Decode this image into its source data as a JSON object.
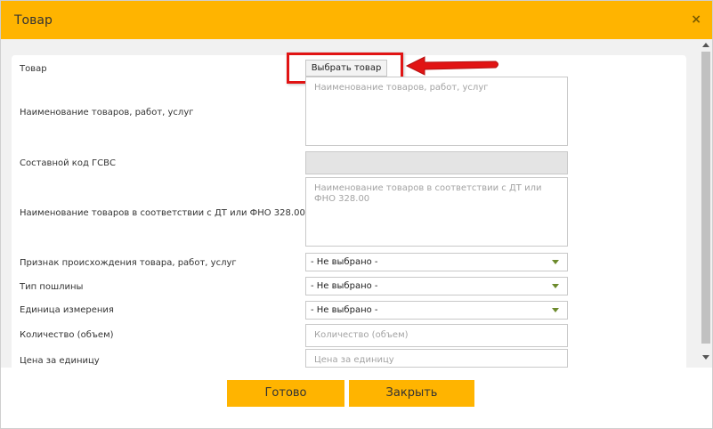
{
  "dialog": {
    "title": "Товар",
    "close_symbol": "×"
  },
  "form": {
    "product_label": "Товар",
    "select_product_button": "Выбрать товар",
    "goods_name_label": "Наименование товаров, работ, услуг",
    "goods_name_placeholder": "Наименование товаров, работ, услуг",
    "gsvs_code_label": "Составной код ГСВС",
    "dt_name_label": "Наименование товаров в соответствии с ДТ или ФНО 328.00",
    "dt_name_placeholder": "Наименование товаров в соответствии с ДТ или ФНО 328.00",
    "origin_label": "Признак происхождения товара, работ, услуг",
    "origin_value": "- Не выбрано -",
    "duty_type_label": "Тип пошлины",
    "duty_type_value": "- Не выбрано -",
    "unit_label": "Единица измерения",
    "unit_value": "- Не выбрано -",
    "quantity_label": "Количество (объем)",
    "quantity_placeholder": "Количество (объем)",
    "price_label": "Цена за единицу",
    "price_placeholder": "Цена за единицу"
  },
  "footer": {
    "done_button": "Готово",
    "close_button": "Закрыть"
  },
  "colors": {
    "accent": "#ffb400",
    "highlight": "#e11414",
    "caret": "#6c8a2c"
  },
  "icons": {
    "close": "close-icon",
    "dropdown": "chevron-down-icon",
    "annotation": "red-arrow-icon"
  }
}
